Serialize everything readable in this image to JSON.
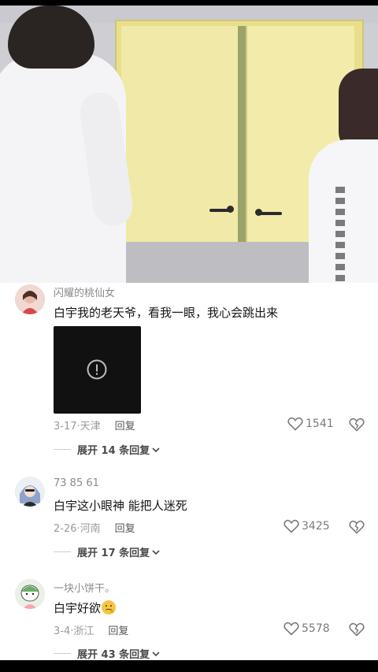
{
  "comments": [
    {
      "username": "闪耀的桃仙女",
      "text": "白宇我的老天爷，看我一眼，我心会跳出来",
      "date": "3-17",
      "location": "天津",
      "reply_label": "回复",
      "likes": "1541",
      "expand_label": "展开 14 条回复",
      "has_media": true
    },
    {
      "username": "73  85  61",
      "text": "白宇这小眼神 能把人迷死",
      "date": "2-26",
      "location": "河南",
      "reply_label": "回复",
      "likes": "3425",
      "expand_label": "展开 17 条回复"
    },
    {
      "username": "一块小饼干。",
      "text": "白宇好欲",
      "date": "3-4",
      "location": "浙江",
      "reply_label": "回复",
      "likes": "5578",
      "expand_label": "展开 43 条回复"
    }
  ],
  "icons": {
    "like": "heart-outline-icon",
    "dislike": "broken-heart-icon",
    "media_error": "alert-circle-icon",
    "expand": "chevron-down-icon"
  }
}
